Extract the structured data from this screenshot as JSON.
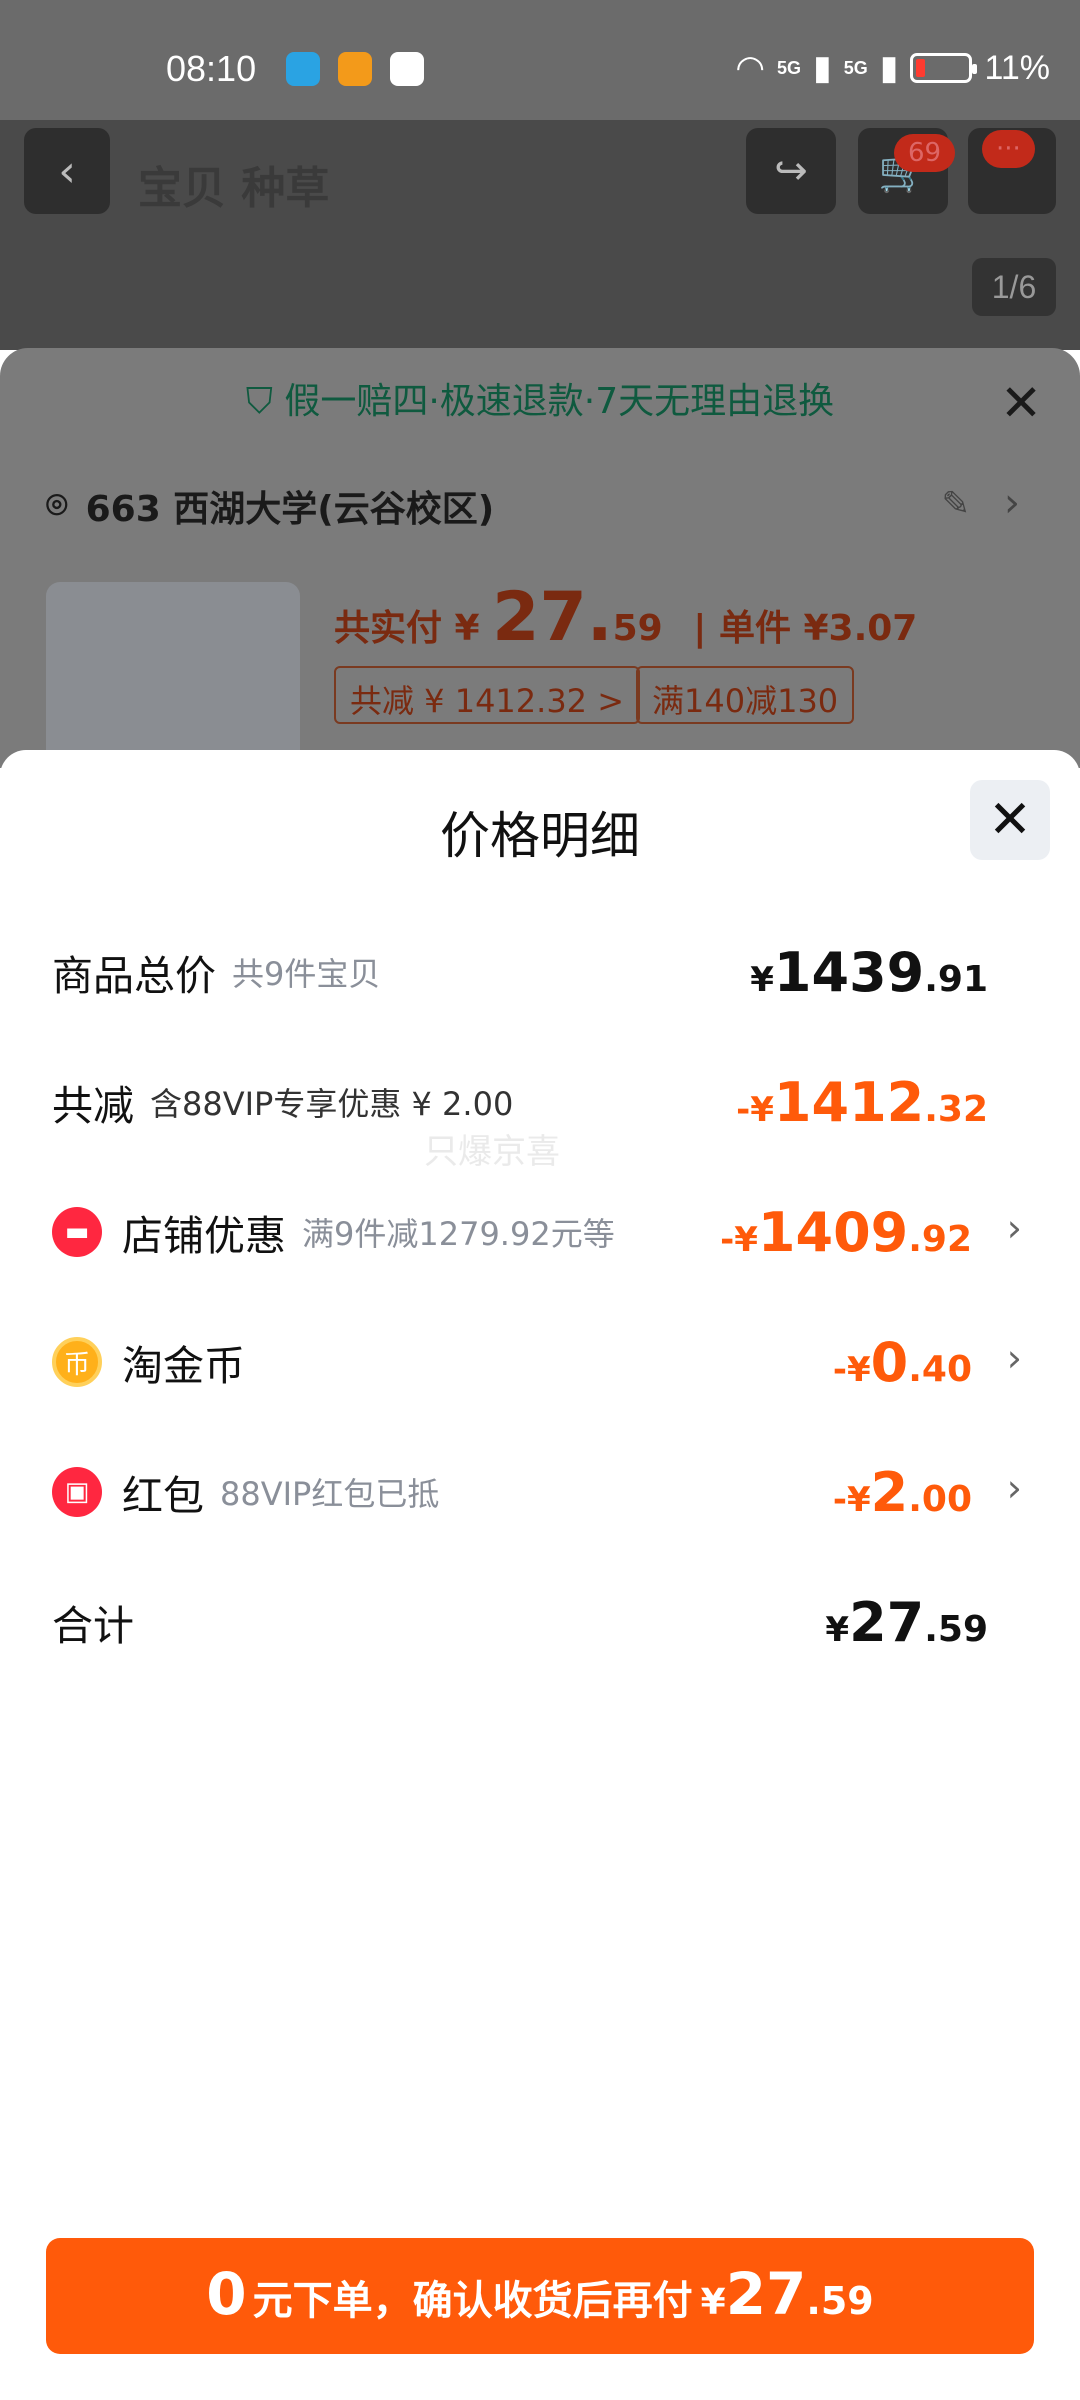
{
  "status_bar": {
    "time": "08:10",
    "signal_1": "5G",
    "signal_2": "5G",
    "battery": "11%"
  },
  "background": {
    "title": "宝贝  种草",
    "cart_badge": "69",
    "more_badge": "···",
    "pager": "1/6",
    "guarantee": "假一赔四·极速退款·7天无理由退换",
    "address": "663 西湖大学(云谷校区)",
    "pay_label": "共实付 ¥",
    "pay_int": "27.",
    "pay_dec": "59",
    "unit_price": "| 单件 ¥3.07",
    "tag_total_discount": "共减 ¥ 1412.32 >",
    "tag_promo": "满140减130"
  },
  "sheet": {
    "title": "价格明细",
    "rows": [
      {
        "label": "商品总价",
        "sub": "共9件宝贝",
        "cur": "¥",
        "int": "1439",
        "dec": ".91"
      },
      {
        "label": "共减",
        "sub": "含88VIP专享优惠 ¥ 2.00",
        "cur": "-¥",
        "int": "1412",
        "dec": ".32"
      },
      {
        "label": "店铺优惠",
        "sub": "满9件减1279.92元等",
        "cur": "-¥",
        "int": "1409",
        "dec": ".92"
      },
      {
        "label": "淘金币",
        "sub": "",
        "cur": "-¥",
        "int": "0",
        "dec": ".40"
      },
      {
        "label": "红包",
        "sub": "88VIP红包已抵",
        "cur": "-¥",
        "int": "2",
        "dec": ".00"
      },
      {
        "label": "合计",
        "sub": "",
        "cur": "¥",
        "int": "27",
        "dec": ".59"
      }
    ],
    "watermark": "只爆京喜"
  },
  "cta": {
    "zero": "0",
    "text": "元下单，确认收货后再付",
    "cur": "¥",
    "int": "27",
    "dec": ".59"
  },
  "colors": {
    "accent": "#ff5a0a",
    "shop_icon": "#ff2740",
    "coin_icon": "#ffb01a"
  }
}
